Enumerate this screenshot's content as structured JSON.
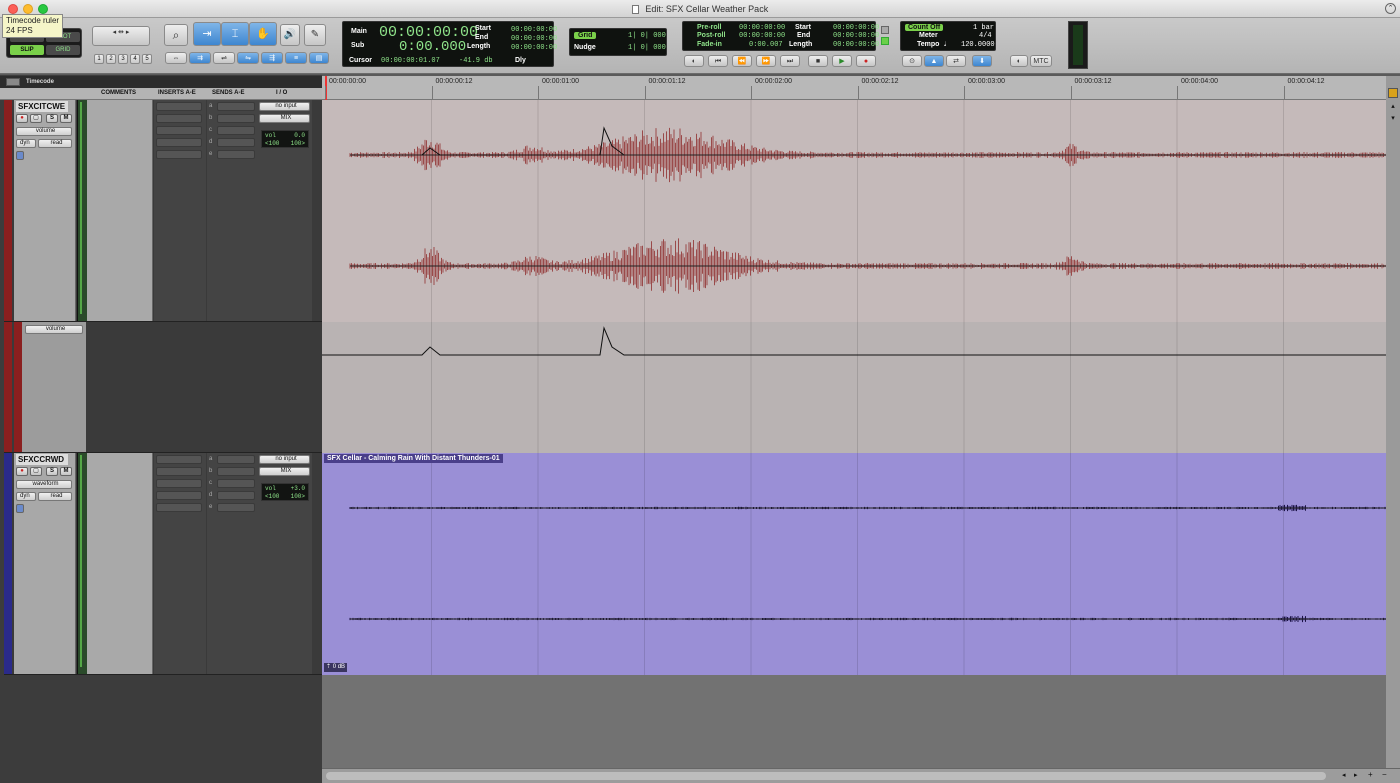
{
  "window": {
    "title": "Edit: SFX Cellar Weather Pack"
  },
  "tooltip": {
    "line1": "Timecode ruler",
    "line2": "24 FPS"
  },
  "modes": {
    "shuffle": "SHUFFLE",
    "spot": "SPOT",
    "slip": "SLIP",
    "grid": "GRID"
  },
  "zoom_presets": [
    "1",
    "2",
    "3",
    "4",
    "5"
  ],
  "counters": {
    "main_label": "Main",
    "main_value": "00:00:00:00",
    "sub_label": "Sub",
    "sub_value": "0:00.000",
    "cursor_label": "Cursor",
    "cursor_value": "00:00:00:01.07",
    "cursor_level": "-41.9 db",
    "dly_label": "Dly",
    "start_label": "Start",
    "start_value": "00:00:00:00",
    "end_label": "End",
    "end_value": "00:00:00:00",
    "length_label": "Length",
    "length_value": "00:00:00:00"
  },
  "grid_nudge": {
    "grid_label": "Grid",
    "grid_value": "1| 0| 000",
    "nudge_label": "Nudge",
    "nudge_value": "1| 0| 000"
  },
  "transport": {
    "preroll_label": "Pre-roll",
    "preroll_value": "00:00:00:00",
    "postroll_label": "Post-roll",
    "postroll_value": "00:00:00:00",
    "fadein_label": "Fade-in",
    "fadein_value": "0:00.007",
    "start_label": "Start",
    "start_value": "00:00:00:00",
    "end_label": "End",
    "end_value": "00:00:00:00",
    "length_label": "Length",
    "length_value": "00:00:00:00"
  },
  "midi": {
    "countoff_label": "Count Off",
    "countoff_value": "1 bar",
    "meter_label": "Meter",
    "meter_value": "4/4",
    "tempo_label": "Tempo",
    "tempo_value": "120.0000"
  },
  "mtc_label": "MTC",
  "timeline": {
    "ruler_name": "Timecode",
    "ticks": [
      "00:00:00:00",
      "00:00:00:12",
      "00:00:01:00",
      "00:00:01:12",
      "00:00:02:00",
      "00:00:02:12",
      "00:00:03:00",
      "00:00:03:12",
      "00:00:04:00",
      "00:00:04:12"
    ]
  },
  "columns": {
    "comments": "COMMENTS",
    "inserts": "INSERTS A-E",
    "sends": "SENDS A-E",
    "io": "I / O"
  },
  "tracks": [
    {
      "name": "SFXCITCWE",
      "color": "#8a1f1f",
      "view": "volume",
      "dyn": "dyn",
      "automation": "read",
      "input": "no input",
      "output": "MIX",
      "vol_label": "vol",
      "vol_value": "0.0",
      "pan_left": "<100",
      "pan_right": "100>",
      "lane_view": "volume",
      "clip_color": "#c5a8a8",
      "wave_color": "#9a4a4a"
    },
    {
      "name": "SFXCCRWD",
      "color": "#2a2a8a",
      "view": "waveform",
      "dyn": "dyn",
      "automation": "read",
      "input": "no input",
      "output": "MIX",
      "vol_label": "vol",
      "vol_value": "+3.0",
      "pan_left": "<100",
      "pan_right": "100>",
      "clip_name": "SFX Cellar - Calming Rain With Distant Thunders-01",
      "clip_gain": "0 dB",
      "clip_color": "#9a8fd6",
      "wave_color": "#1a1245"
    }
  ],
  "send_letters": [
    "a",
    "b",
    "c",
    "d",
    "e"
  ],
  "buttons": {
    "solo": "S",
    "mute": "M"
  }
}
